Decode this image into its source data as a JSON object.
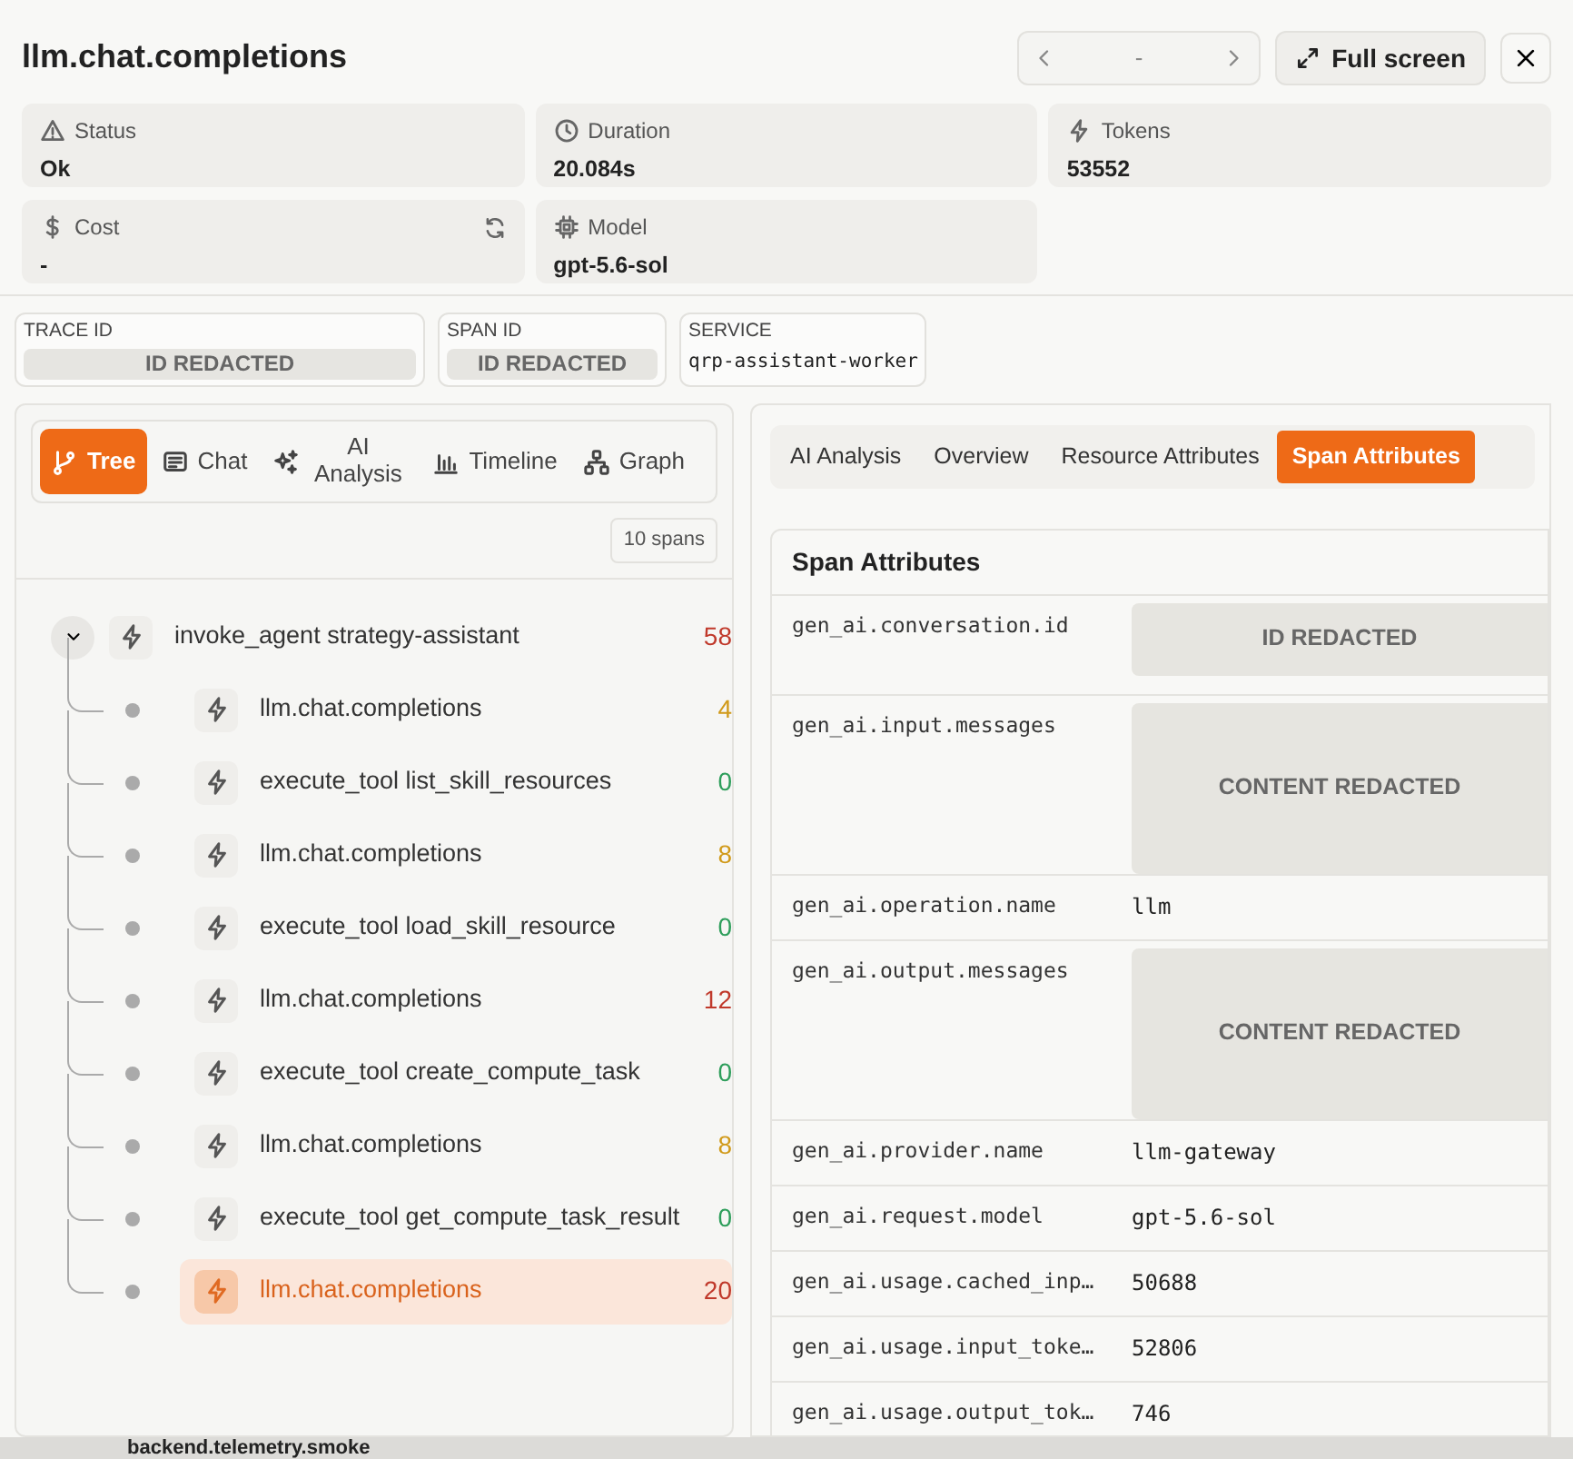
{
  "header": {
    "title": "llm.chat.completions",
    "pager_label": "-",
    "fullscreen_label": "Full screen"
  },
  "metrics": [
    {
      "kind": "status",
      "label": "Status",
      "value": "Ok"
    },
    {
      "kind": "duration",
      "label": "Duration",
      "value": "20.084s"
    },
    {
      "kind": "tokens",
      "label": "Tokens",
      "value": "53552"
    },
    {
      "kind": "cost",
      "label": "Cost",
      "value": "-"
    },
    {
      "kind": "model",
      "label": "Model",
      "value": "gpt-5.6-sol"
    }
  ],
  "ids": [
    {
      "label": "TRACE ID",
      "value": "ID REDACTED",
      "redacted": true
    },
    {
      "label": "SPAN ID",
      "value": "ID REDACTED",
      "redacted": true
    },
    {
      "label": "SERVICE",
      "value": "qrp-assistant-worker",
      "redacted": false
    }
  ],
  "view_tabs": [
    {
      "kind": "tree",
      "label": "Tree",
      "selected": true
    },
    {
      "kind": "chat",
      "label": "Chat",
      "selected": false
    },
    {
      "kind": "ai",
      "label": "AI Analysis",
      "selected": false
    },
    {
      "kind": "timeline",
      "label": "Timeline",
      "selected": false
    },
    {
      "kind": "graph",
      "label": "Graph",
      "selected": false
    }
  ],
  "span_count": "10 spans",
  "tree": {
    "name": "invoke_agent strategy-assistant",
    "duration": "58",
    "color": "#c0392b",
    "expanded": true,
    "selected": false,
    "children": [
      {
        "name": "llm.chat.completions",
        "duration": "4",
        "color": "#d19a1a",
        "selected": false
      },
      {
        "name": "execute_tool list_skill_resources",
        "duration": "0",
        "color": "#2e9e5b",
        "selected": false
      },
      {
        "name": "llm.chat.completions",
        "duration": "8",
        "color": "#d19a1a",
        "selected": false
      },
      {
        "name": "execute_tool load_skill_resource",
        "duration": "0",
        "color": "#2e9e5b",
        "selected": false
      },
      {
        "name": "llm.chat.completions",
        "duration": "12",
        "color": "#c0392b",
        "selected": false
      },
      {
        "name": "execute_tool create_compute_task",
        "duration": "0",
        "color": "#2e9e5b",
        "selected": false
      },
      {
        "name": "llm.chat.completions",
        "duration": "8",
        "color": "#d19a1a",
        "selected": false
      },
      {
        "name": "execute_tool get_compute_task_result",
        "duration": "0",
        "color": "#2e9e5b",
        "selected": false
      },
      {
        "name": "llm.chat.completions",
        "duration": "20",
        "color": "#c0392b",
        "selected": true
      }
    ]
  },
  "detail_tabs": [
    {
      "label": "AI Analysis",
      "selected": false
    },
    {
      "label": "Overview",
      "selected": false
    },
    {
      "label": "Resource Attributes",
      "selected": false
    },
    {
      "label": "Span Attributes",
      "selected": true
    }
  ],
  "attributes": {
    "title": "Span Attributes",
    "rows": [
      {
        "key": "gen_ai.conversation.id",
        "value": "ID REDACTED",
        "kind": "redacted-id"
      },
      {
        "key": "gen_ai.input.messages",
        "value": "CONTENT REDACTED",
        "kind": "redacted-content"
      },
      {
        "key": "gen_ai.operation.name",
        "value": "llm",
        "kind": "text"
      },
      {
        "key": "gen_ai.output.messages",
        "value": "CONTENT REDACTED",
        "kind": "redacted-content"
      },
      {
        "key": "gen_ai.provider.name",
        "value": "llm-gateway",
        "kind": "text"
      },
      {
        "key": "gen_ai.request.model",
        "value": "gpt-5.6-sol",
        "kind": "text"
      },
      {
        "key": "gen_ai.usage.cached_inp…",
        "value": "50688",
        "kind": "text"
      },
      {
        "key": "gen_ai.usage.input_toke…",
        "value": "52806",
        "kind": "text"
      },
      {
        "key": "gen_ai.usage.output_tok…",
        "value": "746",
        "kind": "text"
      }
    ]
  },
  "background_page": {
    "item": "backend.telemetry.smoke"
  }
}
